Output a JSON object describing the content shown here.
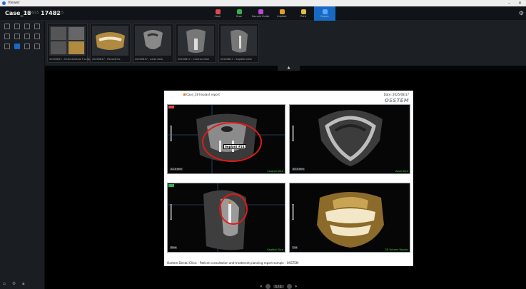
{
  "window": {
    "title": "Viewer",
    "minimize": "–",
    "close": "×"
  },
  "header": {
    "case_name": "Case_18",
    "case_sub": "M/56/25",
    "case_id": "17482",
    "case_id_sub": "48.5",
    "modules": [
      {
        "label": "Ceph",
        "color": "#e04848",
        "active": false
      },
      {
        "label": "Scan",
        "color": "#33b24a",
        "active": false
      },
      {
        "label": "Sample Guide",
        "color": "#b84cd1",
        "active": false
      },
      {
        "label": "Implant",
        "color": "#e0a020",
        "active": false
      },
      {
        "label": "Print",
        "color": "#e0c040",
        "active": false
      },
      {
        "label": "Report",
        "color": "#5aa8ff",
        "active": true
      }
    ]
  },
  "thumbnails": [
    {
      "caption": "20250817 - Multi-window 5 screen",
      "type": "multi"
    },
    {
      "caption": "20250817 - Panoramic",
      "type": "pano"
    },
    {
      "caption": "20250817 - Axial view",
      "type": "axial"
    },
    {
      "caption": "20250817 - Coronal view",
      "type": "coronal"
    },
    {
      "caption": "20250817 - Sagittal view",
      "type": "sagittal"
    }
  ],
  "page": {
    "filename": "Case_18 Implant report",
    "date": "Date: 2025/08/17",
    "brand": "OSSTEM",
    "footer": "Osstem Dental Clinic - Patient consultation and treatment planning report sample - OSSTEM",
    "annotation": "Implant #21",
    "panels": [
      {
        "caption": "Coronal Slice",
        "num": "12.5 mm"
      },
      {
        "caption": "Axial Slice",
        "num": "15.0 mm"
      },
      {
        "caption": "Sagittal Slice",
        "num": "Slice"
      },
      {
        "caption": "3D Volume Render",
        "num": "Cut"
      }
    ]
  },
  "pager": {
    "prev": "«",
    "page": "1 / 1",
    "next": "»"
  }
}
